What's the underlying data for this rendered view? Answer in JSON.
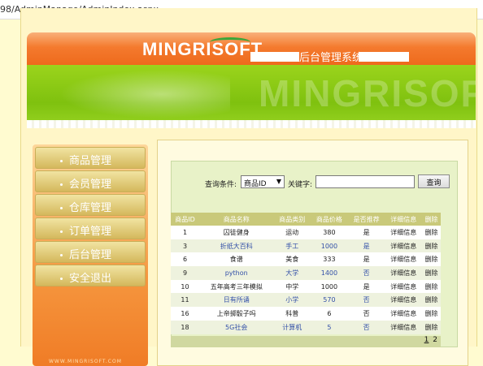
{
  "urlbar": {
    "url": "98/AdminManage/AdminIndex.aspx"
  },
  "banner": {
    "logo": "MINGRISOFT",
    "title": "后台管理系统",
    "bg_word": "MINGRISOFT"
  },
  "sidebar": {
    "items": [
      {
        "label": "商品管理"
      },
      {
        "label": "会员管理"
      },
      {
        "label": "仓库管理"
      },
      {
        "label": "订单管理"
      },
      {
        "label": "后台管理"
      },
      {
        "label": "安全退出"
      }
    ],
    "footer": "WWW.MINGRISOFT.COM"
  },
  "search": {
    "condition_label": "查询条件:",
    "select_value": "商品ID",
    "keyword_label": "关键字:",
    "keyword_value": "",
    "button_label": "查询"
  },
  "table": {
    "headers": [
      "商品ID",
      "商品名称",
      "商品类别",
      "商品价格",
      "是否推荐",
      "详细信息",
      "删除"
    ],
    "rows": [
      [
        "1",
        "囚徒健身",
        "运动",
        "380",
        "是",
        "详细信息",
        "删除"
      ],
      [
        "3",
        "折纸大百科",
        "手工",
        "1000",
        "是",
        "详细信息",
        "删除"
      ],
      [
        "6",
        "食谱",
        "美食",
        "333",
        "是",
        "详细信息",
        "删除"
      ],
      [
        "9",
        "python",
        "大学",
        "1400",
        "否",
        "详细信息",
        "删除"
      ],
      [
        "10",
        "五年高考三年模拟",
        "中学",
        "1000",
        "是",
        "详细信息",
        "删除"
      ],
      [
        "11",
        "日有所诵",
        "小学",
        "570",
        "否",
        "详细信息",
        "删除"
      ],
      [
        "16",
        "上帝掷骰子吗",
        "科普",
        "6",
        "否",
        "详细信息",
        "删除"
      ],
      [
        "18",
        "5G社会",
        "计算机",
        "5",
        "否",
        "详细信息",
        "删除"
      ]
    ]
  },
  "pager": {
    "pages": [
      "1",
      "2"
    ],
    "current": "1"
  },
  "colors": {
    "header_orange": "#f47a2e",
    "banner_green": "#7fc10f",
    "table_header": "#c9c97a",
    "link_blue": "#3350a8"
  }
}
